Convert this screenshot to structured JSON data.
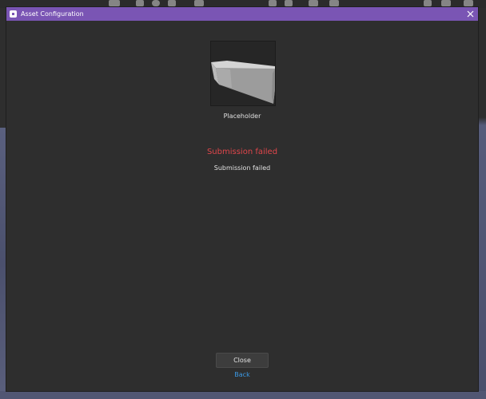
{
  "window": {
    "title": "Asset Configuration",
    "close_icon": "close-icon",
    "titlebar_color": "#7a55b4"
  },
  "asset": {
    "name": "Placeholder",
    "thumbnail_icon": "wedge-part-icon"
  },
  "status": {
    "title": "Submission failed",
    "message": "Submission failed",
    "title_color": "#e0464b"
  },
  "actions": {
    "close_label": "Close",
    "back_label": "Back",
    "link_color": "#3b9ae6"
  }
}
